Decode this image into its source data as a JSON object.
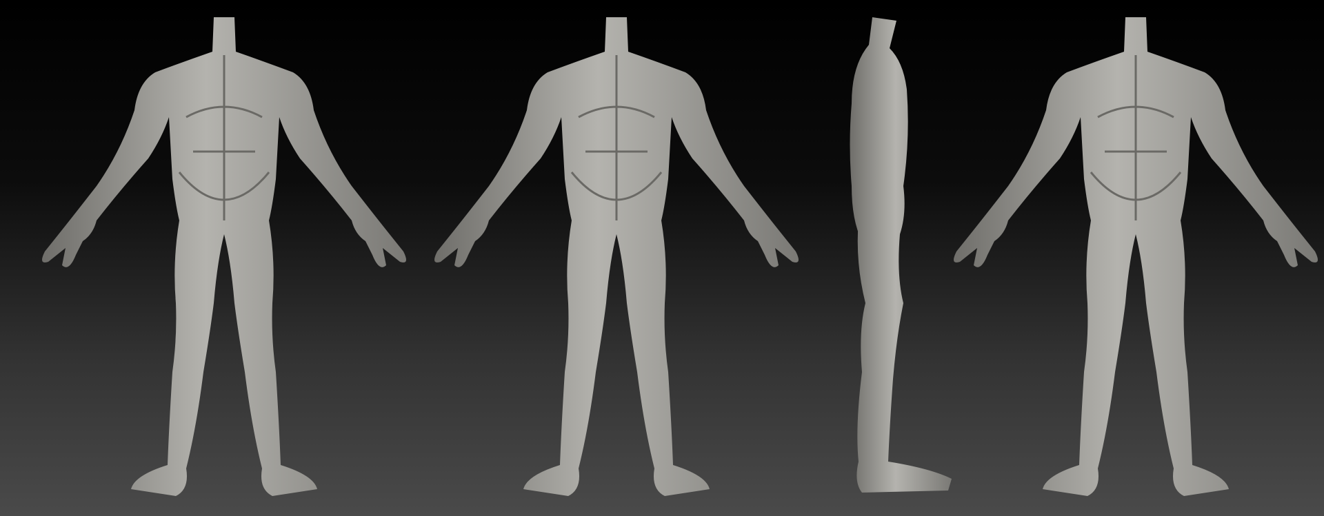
{
  "colors": {
    "background_top": "#000000",
    "background_bottom": "#4a4a4a",
    "clay_light": "#b4b3ae",
    "clay_dark": "#6f6e6a"
  }
}
